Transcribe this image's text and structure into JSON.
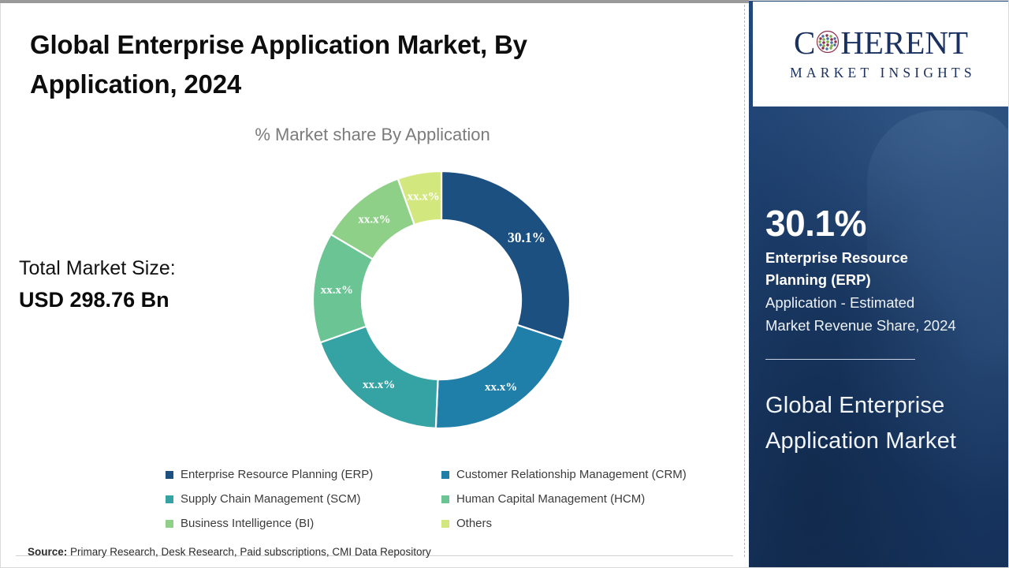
{
  "header": {
    "title": "Global Enterprise Application Market, By Application, 2024",
    "subtitle": "% Market share By Application"
  },
  "total_market": {
    "label": "Total Market Size:",
    "value": "USD 298.76 Bn"
  },
  "logo": {
    "word_start": "C",
    "word_end": "HERENT",
    "tagline": "MARKET INSIGHTS",
    "color": "#1b3160",
    "globe_icon": "globe-dots-icon"
  },
  "highlight": {
    "percent": "30.1%",
    "bold_text": "Enterprise Resource Planning (ERP)",
    "light_text": "Application - Estimated Market Revenue Share, 2024",
    "heading": "Global Enterprise Application Market"
  },
  "footer": {
    "source_label": "Source:",
    "source_text": "Primary Research, Desk Research, Paid subscriptions, CMI Data Repository"
  },
  "legend": [
    {
      "label": "Enterprise Resource Planning (ERP)",
      "color": "#1b5080"
    },
    {
      "label": "Customer Relationship Management (CRM)",
      "color": "#1f7fa8"
    },
    {
      "label": "Supply Chain Management (SCM)",
      "color": "#35a2a3"
    },
    {
      "label": "Human Capital Management (HCM)",
      "color": "#6bc494"
    },
    {
      "label": "Business Intelligence (BI)",
      "color": "#8fd089"
    },
    {
      "label": "Others",
      "color": "#d2e87f"
    }
  ],
  "chart_data": {
    "type": "pie",
    "variant": "donut",
    "title": "% Market share By Application",
    "unit": "%",
    "total_market_size": "USD 298.76 Bn",
    "start_angle_deg": 0,
    "direction": "clockwise",
    "inner_radius_ratio": 0.62,
    "categories": [
      "Enterprise Resource Planning (ERP)",
      "Customer Relationship Management (CRM)",
      "Supply Chain Management (SCM)",
      "Human Capital Management (HCM)",
      "Business Intelligence (BI)",
      "Others"
    ],
    "values": [
      30.1,
      20.6,
      18.9,
      13.9,
      11.0,
      5.5
    ],
    "data_labels": [
      "30.1%",
      "xx.x%",
      "xx.x%",
      "xx.x%",
      "xx.x%",
      "xx.x%"
    ],
    "colors": [
      "#1b5080",
      "#1f7fa8",
      "#35a2a3",
      "#6bc494",
      "#8fd089",
      "#d2e87f"
    ],
    "legend_position": "bottom",
    "grid": false
  }
}
